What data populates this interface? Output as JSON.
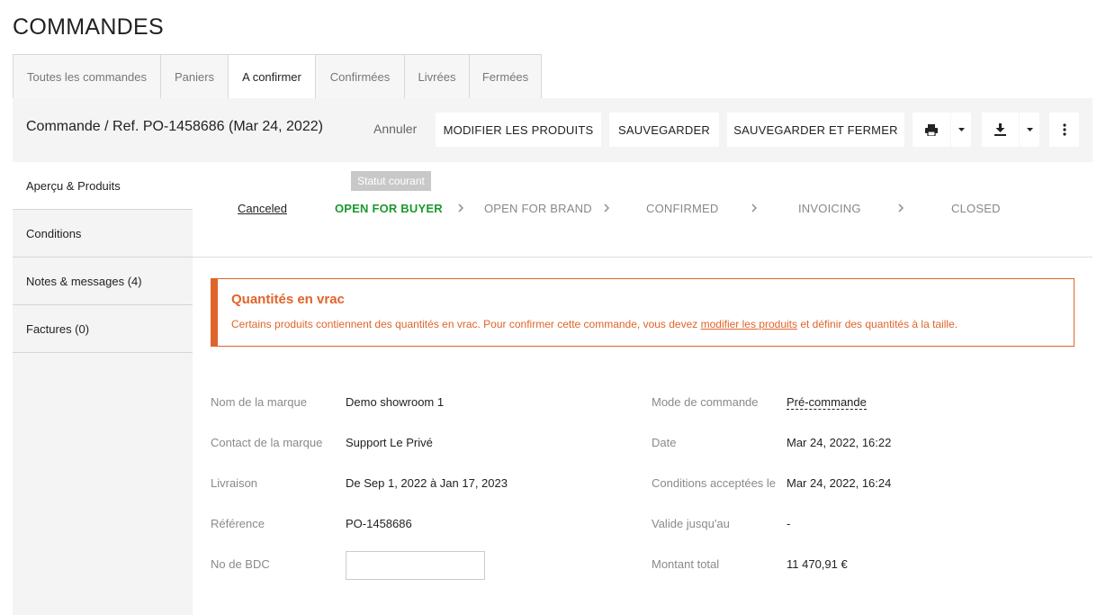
{
  "page_title": "COMMANDES",
  "tabs": [
    {
      "label": "Toutes les commandes"
    },
    {
      "label": "Paniers"
    },
    {
      "label": "A confirmer"
    },
    {
      "label": "Confirmées"
    },
    {
      "label": "Livrées"
    },
    {
      "label": "Fermées"
    }
  ],
  "toolbar": {
    "order_title": "Commande / Ref. PO-1458686 (Mar 24, 2022)",
    "cancel_label": "Annuler",
    "modify_label": "MODIFIER LES PRODUITS",
    "save_label": "SAUVEGARDER",
    "save_close_label": "SAUVEGARDER ET FERMER",
    "print_icon": "printer-icon",
    "download_icon": "download-icon",
    "more_icon": "more-vertical-icon"
  },
  "sidebar": {
    "items": [
      {
        "label": "Aperçu & Produits"
      },
      {
        "label": "Conditions"
      },
      {
        "label": "Notes & messages (4)"
      },
      {
        "label": "Factures (0)"
      }
    ]
  },
  "status": {
    "tooltip": "Statut courant",
    "steps": [
      {
        "label": "Canceled"
      },
      {
        "label": "OPEN FOR BUYER"
      },
      {
        "label": "OPEN FOR BRAND"
      },
      {
        "label": "CONFIRMED"
      },
      {
        "label": "INVOICING"
      },
      {
        "label": "CLOSED"
      }
    ],
    "current_color": "#1a9a2e"
  },
  "alert": {
    "title": "Quantités en vrac",
    "text_before": "Certains produits contiennent des quantités en vrac. Pour confirmer cette commande, vous devez ",
    "link": "modifier les produits",
    "text_after": " et définir des quantités à la taille.",
    "color": "#e0642a"
  },
  "details": {
    "left": [
      {
        "label": "Nom de la marque",
        "value": "Demo showroom 1"
      },
      {
        "label": "Contact de la marque",
        "value": "Support Le Privé"
      },
      {
        "label": "Livraison",
        "value": "De Sep 1, 2022 à Jan 17, 2023"
      },
      {
        "label": "Référence",
        "value": "PO-1458686"
      },
      {
        "label": "No de BDC",
        "value": ""
      }
    ],
    "right": [
      {
        "label": "Mode de commande",
        "value": "Pré-commande"
      },
      {
        "label": "Date",
        "value": "Mar 24, 2022, 16:22"
      },
      {
        "label": "Conditions acceptées le",
        "value": "Mar 24, 2022, 16:24"
      },
      {
        "label": "Valide jusqu'au",
        "value": "-"
      },
      {
        "label": "Montant total",
        "value": "11 470,91 €"
      }
    ]
  }
}
